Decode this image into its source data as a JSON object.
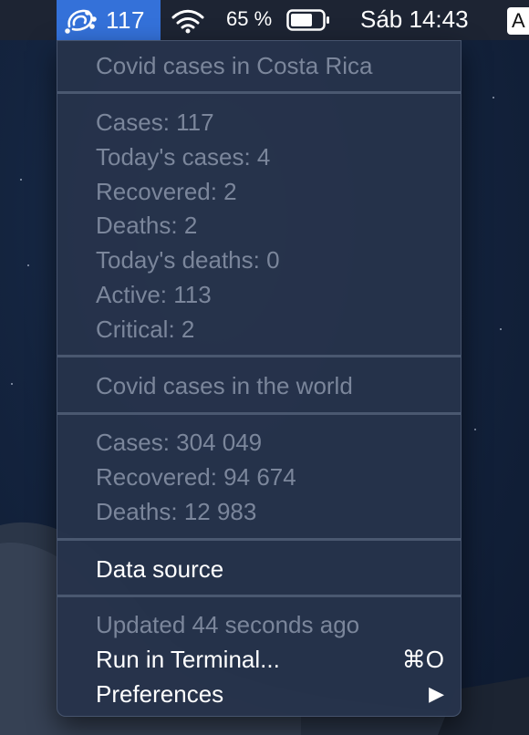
{
  "menubar": {
    "status_count": "117",
    "battery_percent": "65 %",
    "clock": "Sáb 14:43",
    "input_source": "A",
    "icons": [
      "virus-icon",
      "wifi-icon",
      "battery-icon"
    ]
  },
  "menu": {
    "country_header": "Covid cases in Costa Rica",
    "country_stats": [
      "Cases: 117",
      "Today's cases: 4",
      "Recovered: 2",
      "Deaths: 2",
      "Today's deaths: 0",
      "Active: 113",
      "Critical: 2"
    ],
    "world_header": "Covid cases in the world",
    "world_stats": [
      "Cases: 304 049",
      "Recovered: 94 674",
      "Deaths: 12 983"
    ],
    "data_source": "Data source",
    "updated": "Updated 44 seconds ago",
    "run_terminal": "Run in Terminal...",
    "run_terminal_shortcut": "⌘O",
    "preferences": "Preferences",
    "preferences_arrow": "▶"
  }
}
